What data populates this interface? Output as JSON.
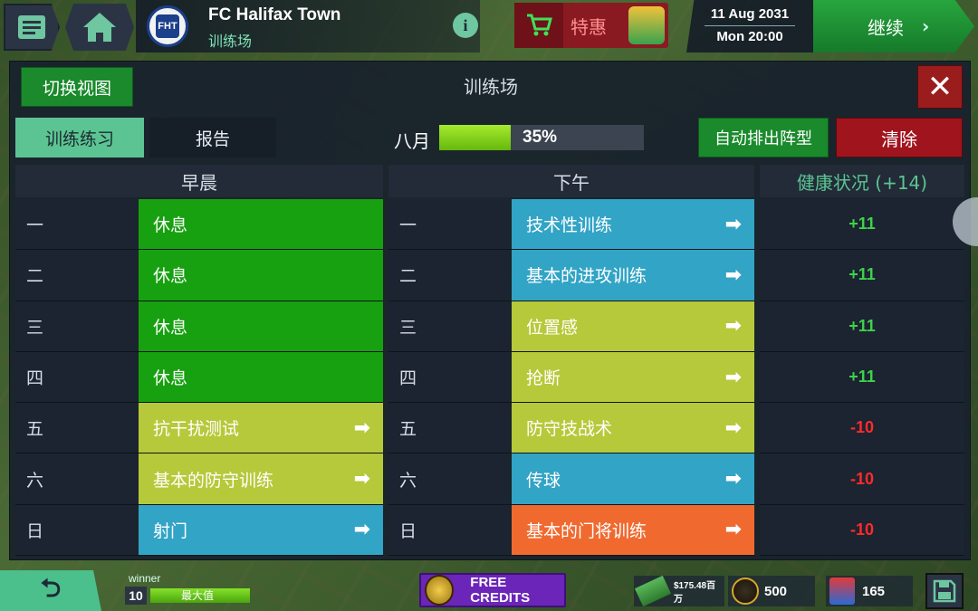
{
  "topbar": {
    "club_name": "FC Halifax Town",
    "club_sub": "训练场",
    "crest_text": "FHT",
    "deal_label": "特惠",
    "date": "11 Aug 2031",
    "time": "Mon 20:00",
    "continue_label": "继续",
    "continue_chevron": "›",
    "info_label": "i"
  },
  "panel": {
    "title": "训练场",
    "switch_view_label": "切换视图",
    "close_label": "✕",
    "tabs": [
      {
        "label": "训练练习",
        "active": true
      },
      {
        "label": "报告",
        "active": false
      }
    ],
    "month_label": "八月",
    "progress": 35,
    "progress_text": "35%",
    "auto_label": "自动排出阵型",
    "clear_label": "清除"
  },
  "columns": {
    "morning": "早晨",
    "afternoon": "下午",
    "health": "健康状况 (+14)"
  },
  "colors": {
    "green": "#17a010",
    "teal": "#32a4c6",
    "olive": "#b6c93a",
    "orange": "#f06a30",
    "positive": "#3fd14a",
    "negative": "#ff2a2a"
  },
  "schedule": [
    {
      "day": "一",
      "morning": "休息",
      "morning_color": "green",
      "morning_arrow": false,
      "afternoon": "技术性训练",
      "afternoon_color": "teal",
      "health": "+11",
      "health_type": "positive"
    },
    {
      "day": "二",
      "morning": "休息",
      "morning_color": "green",
      "morning_arrow": false,
      "afternoon": "基本的进攻训练",
      "afternoon_color": "teal",
      "health": "+11",
      "health_type": "positive"
    },
    {
      "day": "三",
      "morning": "休息",
      "morning_color": "green",
      "morning_arrow": false,
      "afternoon": "位置感",
      "afternoon_color": "olive",
      "health": "+11",
      "health_type": "positive"
    },
    {
      "day": "四",
      "morning": "休息",
      "morning_color": "green",
      "morning_arrow": false,
      "afternoon": "抢断",
      "afternoon_color": "olive",
      "health": "+11",
      "health_type": "positive"
    },
    {
      "day": "五",
      "morning": "抗干扰测试",
      "morning_color": "olive",
      "morning_arrow": true,
      "afternoon": "防守技战术",
      "afternoon_color": "olive",
      "health": "-10",
      "health_type": "negative"
    },
    {
      "day": "六",
      "morning": "基本的防守训练",
      "morning_color": "olive",
      "morning_arrow": true,
      "afternoon": "传球",
      "afternoon_color": "teal",
      "health": "-10",
      "health_type": "negative"
    },
    {
      "day": "日",
      "morning": "射门",
      "morning_color": "teal",
      "morning_arrow": true,
      "afternoon": "基本的门将训练",
      "afternoon_color": "orange",
      "health": "-10",
      "health_type": "negative"
    }
  ],
  "bottom": {
    "back_label": "⮌",
    "player_name": "winner",
    "level": "10",
    "xp_label": "最大值",
    "xp_fraction": 1.0,
    "credits_label": "FREE CREDITS",
    "cash": "$175.48百万",
    "gold": "500",
    "cards": "165"
  },
  "icons": [
    "menu-icon",
    "home-icon",
    "cart-icon",
    "info-icon",
    "close-icon",
    "arrow-right-icon",
    "back-icon",
    "coin-icon",
    "cash-icon",
    "cards-icon",
    "save-icon"
  ]
}
